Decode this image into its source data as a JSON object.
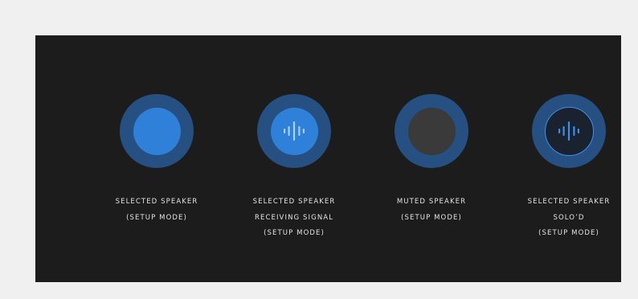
{
  "colors": {
    "page_background": "#f0f0f0",
    "panel_background": "#1c1c1c",
    "ring": "#264f82",
    "selected_fill": "#2f80d8",
    "muted_fill": "#3a3a3a",
    "solo_border": "#3f8fe6",
    "wave_on_fill": "#a9d0ff",
    "wave_on_outline": "#3f8fe6"
  },
  "speakers": [
    {
      "state": "selected",
      "icon": "speaker-selected-icon",
      "label_lines": [
        "SELECTED SPEAKER",
        "(SETUP MODE)"
      ]
    },
    {
      "state": "receiving-signal",
      "icon": "sound-wave-icon",
      "label_lines": [
        "SELECTED SPEAKER",
        "RECEIVING SIGNAL",
        "(SETUP MODE)"
      ]
    },
    {
      "state": "muted",
      "icon": "speaker-muted-icon",
      "label_lines": [
        "MUTED SPEAKER",
        "(SETUP MODE)"
      ]
    },
    {
      "state": "solo",
      "icon": "sound-wave-icon",
      "label_lines": [
        "SELECTED SPEAKER",
        "SOLO’D",
        "(SETUP MODE)"
      ]
    }
  ]
}
